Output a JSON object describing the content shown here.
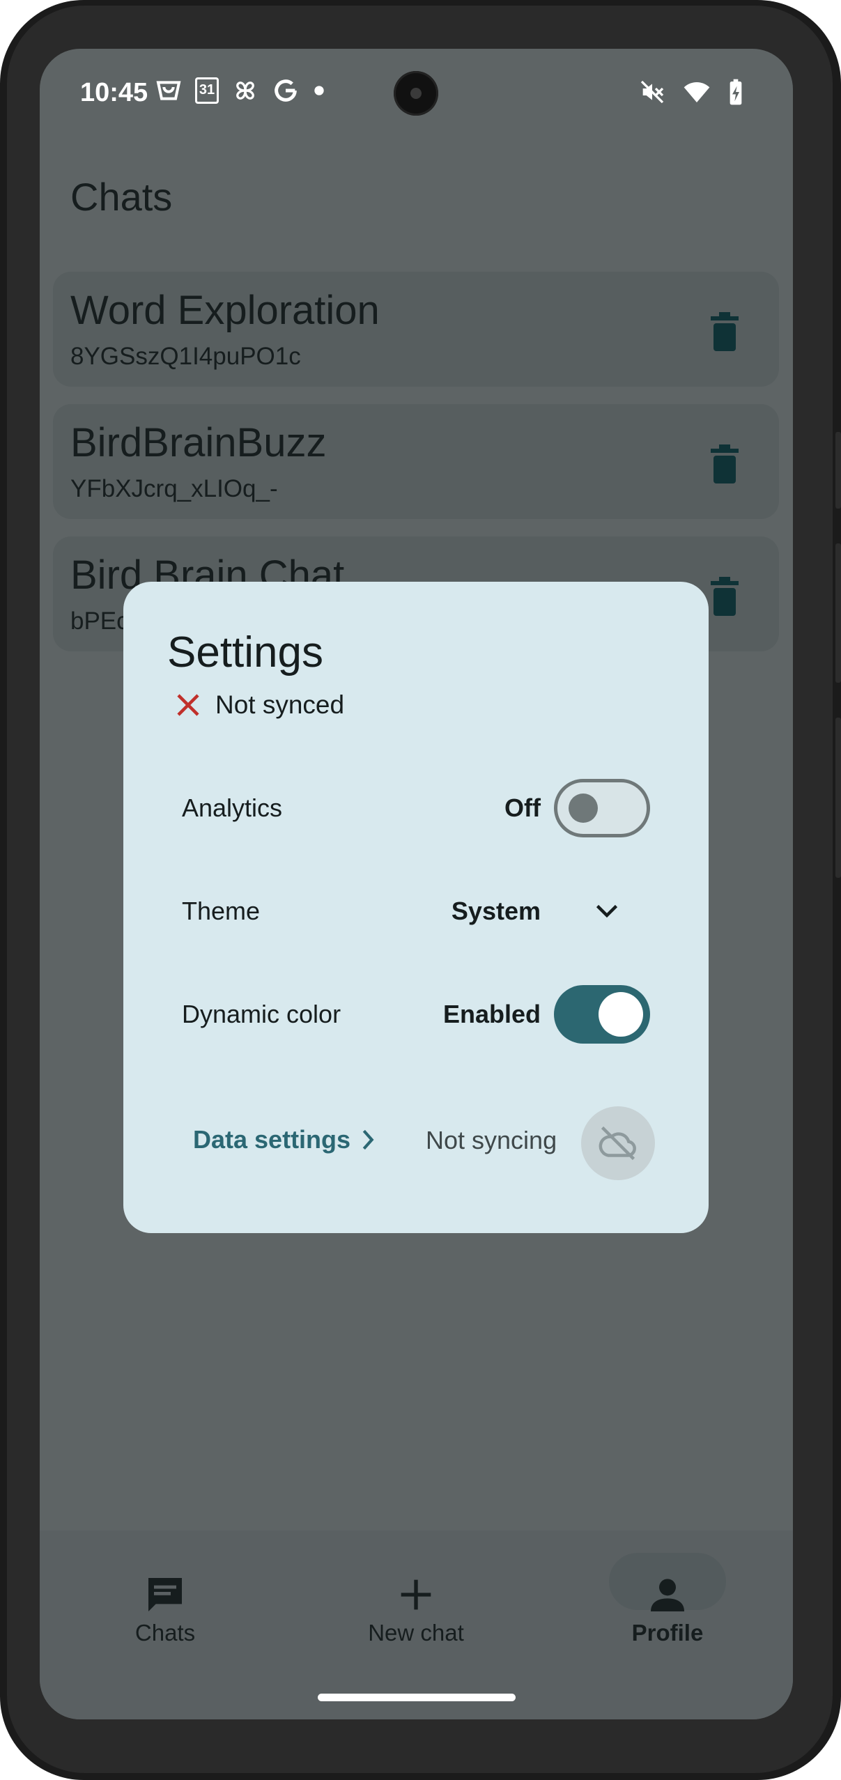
{
  "status_bar": {
    "time": "10:45",
    "left_icons": [
      "shopping-bag-icon",
      "calendar-icon",
      "pinwheel-icon",
      "google-icon",
      "dot-icon"
    ],
    "calendar_day": "31",
    "right_icons": [
      "vibrate-off-icon",
      "wifi-icon",
      "battery-charging-icon"
    ]
  },
  "page": {
    "title": "Chats"
  },
  "chats": [
    {
      "title": "Word Exploration",
      "id": "8YGSszQ1I4puPO1c"
    },
    {
      "title": "BirdBrainBuzz",
      "id": "YFbXJcrq_xLIOq_-"
    },
    {
      "title": "Bird Brain Chat",
      "id": "bPEc"
    }
  ],
  "dialog": {
    "title": "Settings",
    "sync_status": "Not synced",
    "rows": {
      "analytics": {
        "label": "Analytics",
        "value": "Off",
        "enabled": false
      },
      "theme": {
        "label": "Theme",
        "value": "System"
      },
      "dynamic_color": {
        "label": "Dynamic color",
        "value": "Enabled",
        "enabled": true
      }
    },
    "data_settings_label": "Data settings",
    "syncing_status": "Not syncing"
  },
  "bottom_nav": [
    {
      "label": "Chats",
      "icon": "chat-icon",
      "selected": false
    },
    {
      "label": "New chat",
      "icon": "plus-icon",
      "selected": false
    },
    {
      "label": "Profile",
      "icon": "person-icon",
      "selected": true
    }
  ],
  "colors": {
    "accent": "#2c6771",
    "dialog_background": "#d8e9ee",
    "scrim_background": "#5e6465",
    "error_x": "#c0302b"
  }
}
